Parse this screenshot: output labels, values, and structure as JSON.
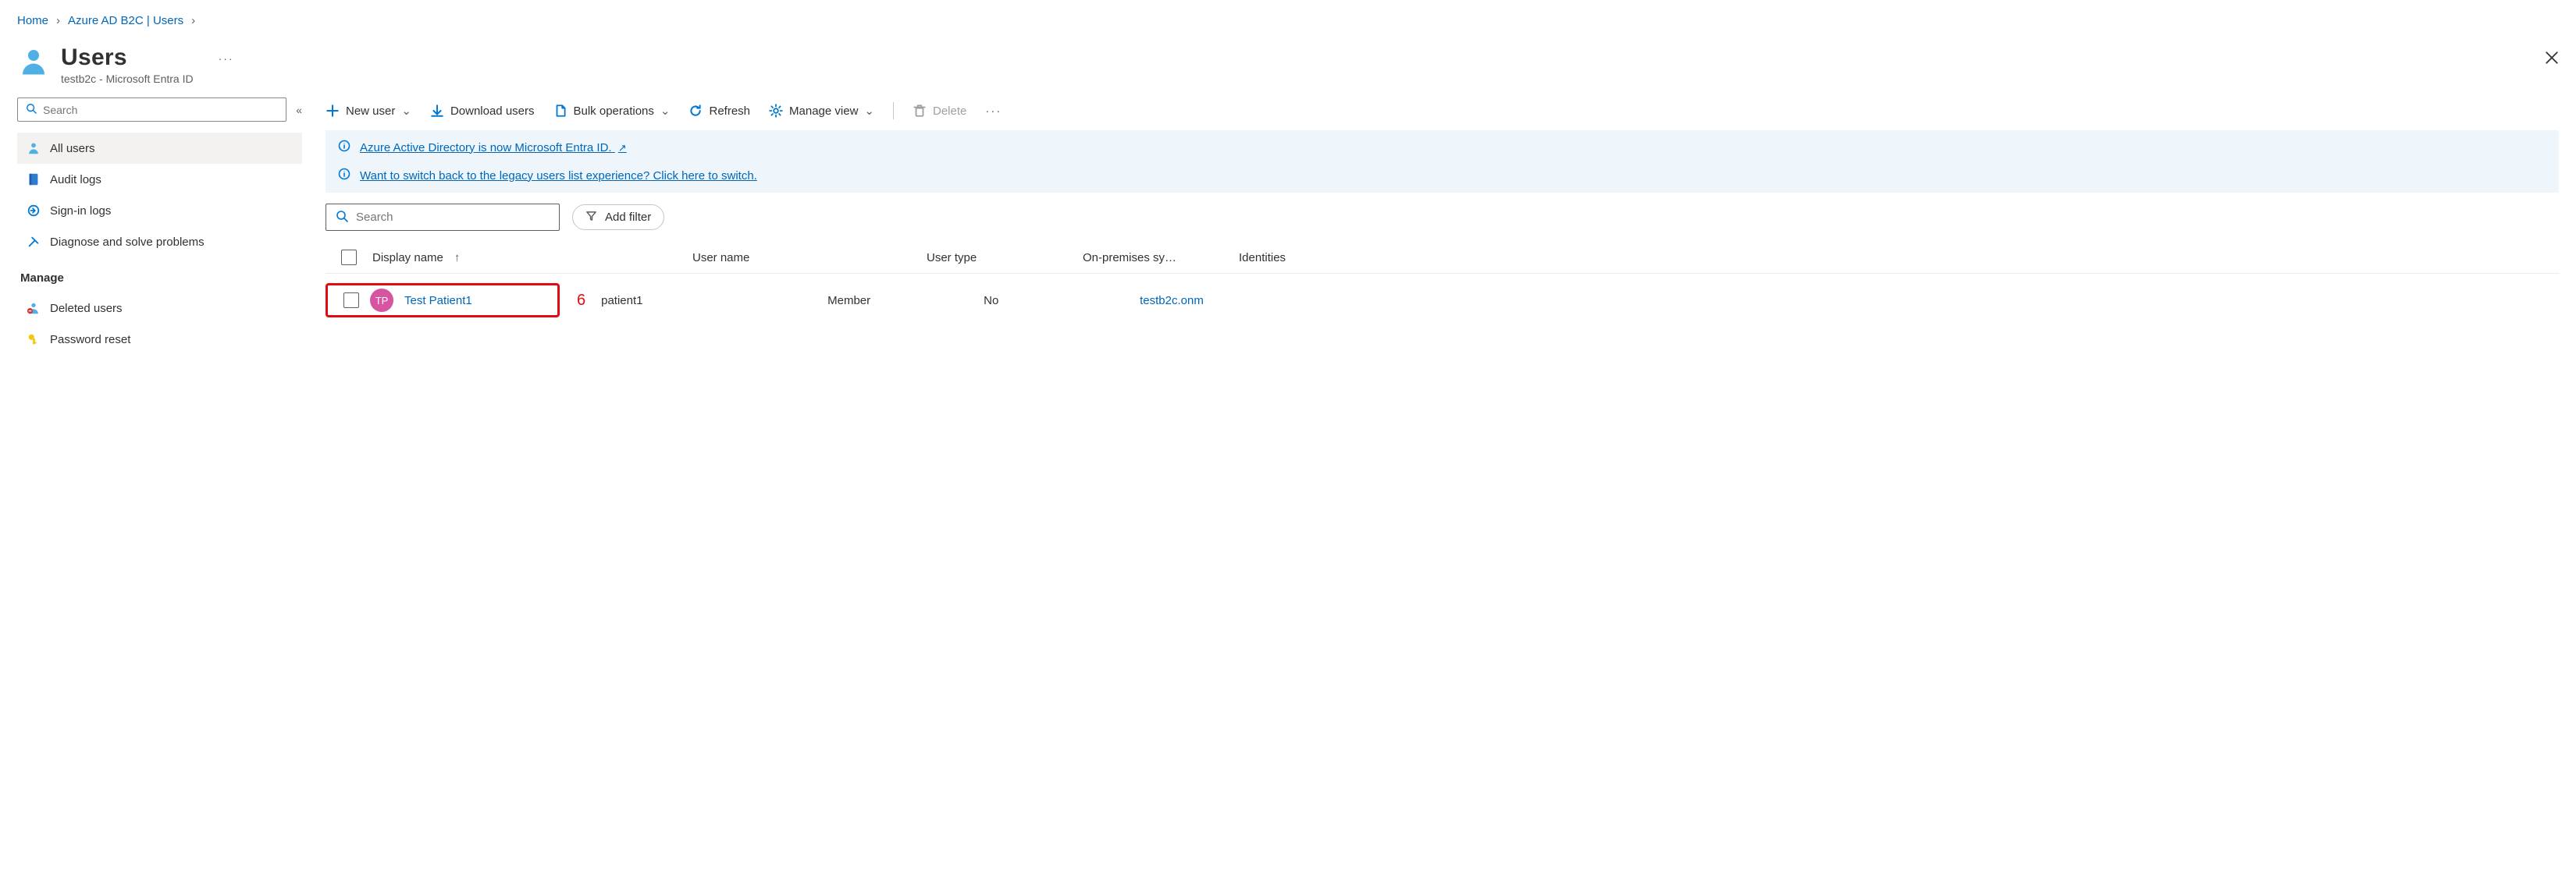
{
  "breadcrumb": {
    "home": "Home",
    "parent": "Azure AD B2C | Users"
  },
  "title": {
    "heading": "Users",
    "subtitle": "testb2c - Microsoft Entra ID"
  },
  "sidebar": {
    "search_placeholder": "Search",
    "items": [
      {
        "key": "all-users",
        "label": "All users",
        "icon": "person-icon",
        "active": true
      },
      {
        "key": "audit-logs",
        "label": "Audit logs",
        "icon": "book-icon",
        "active": false
      },
      {
        "key": "sign-in-logs",
        "label": "Sign-in logs",
        "icon": "signin-icon",
        "active": false
      },
      {
        "key": "diagnose",
        "label": "Diagnose and solve problems",
        "icon": "tools-icon",
        "active": false
      }
    ],
    "section_manage": "Manage",
    "manage_items": [
      {
        "key": "deleted-users",
        "label": "Deleted users",
        "icon": "person-remove-icon"
      },
      {
        "key": "password-reset",
        "label": "Password reset",
        "icon": "key-icon"
      }
    ]
  },
  "toolbar": {
    "new_user": "New user",
    "download_users": "Download users",
    "bulk_operations": "Bulk operations",
    "refresh": "Refresh",
    "manage_view": "Manage view",
    "delete": "Delete"
  },
  "banners": {
    "entra_notice": "Azure Active Directory is now Microsoft Entra ID.",
    "legacy_notice": "Want to switch back to the legacy users list experience? Click here to switch."
  },
  "filters": {
    "search_placeholder": "Search",
    "add_filter": "Add filter"
  },
  "table": {
    "columns": {
      "display_name": "Display name",
      "user_name": "User name",
      "user_type": "User type",
      "on_prem": "On-premises sy…",
      "identities": "Identities"
    },
    "rows": [
      {
        "avatar_initials": "TP",
        "avatar_color": "#d754a1",
        "display_name": "Test Patient1",
        "user_name": "patient1",
        "user_type": "Member",
        "on_prem": "No",
        "identities": "testb2c.onm"
      }
    ],
    "annotation": "6"
  }
}
